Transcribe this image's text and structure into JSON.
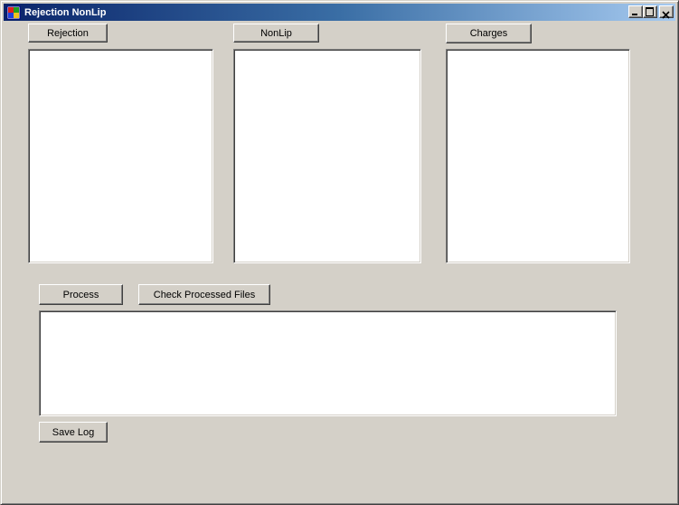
{
  "window": {
    "title": "Rejection NonLip",
    "minimize_symbol": "_",
    "maximize_symbol": "□",
    "close_symbol": "×"
  },
  "buttons": {
    "rejection": "Rejection",
    "nonlip": "NonLip",
    "charges": "Charges",
    "process": "Process",
    "check_processed": "Check Processed Files",
    "save_log": "Save Log"
  },
  "icons": {
    "app": "application-icon",
    "minimize": "minimize-icon",
    "maximize": "maximize-icon",
    "close": "close-icon"
  },
  "colors": {
    "title_gradient_start": "#0a246a",
    "title_gradient_end": "#a6caf0",
    "face": "#d4d0c8"
  }
}
